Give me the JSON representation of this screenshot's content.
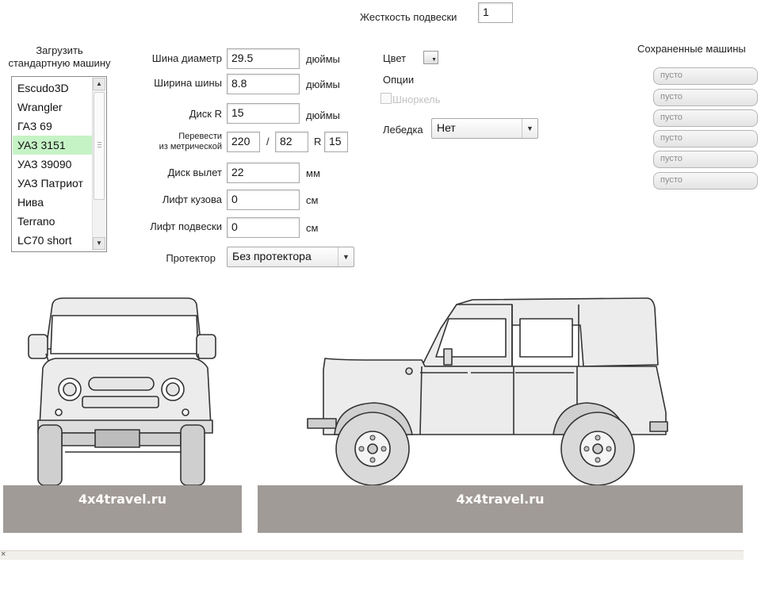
{
  "suspension": {
    "label": "Жесткость подвески",
    "value": "1"
  },
  "load_car": {
    "label_line1": "Загрузить",
    "label_line2": "стандартную машину"
  },
  "car_list": {
    "items": [
      "Escudo3D",
      "Wrangler",
      "ГАЗ 69",
      "УАЗ 3151",
      "УАЗ 39090",
      "УАЗ Патриот",
      "Нива",
      "Terrano",
      "LC70 short"
    ],
    "selected": "УАЗ 3151"
  },
  "fields": {
    "tire_diameter": {
      "label": "Шина диаметр",
      "value": "29.5",
      "unit": "дюймы"
    },
    "tire_width": {
      "label": "Ширина шины",
      "value": "8.8",
      "unit": "дюймы"
    },
    "rim": {
      "label": "Диск R",
      "value": "15",
      "unit": "дюймы"
    },
    "convert": {
      "label_line1": "Перевести",
      "label_line2": "из метрической",
      "width": "220",
      "sep": "/",
      "profile": "82",
      "r_label": "R",
      "radius": "15"
    },
    "offset": {
      "label": "Диск вылет",
      "value": "22",
      "unit": "мм"
    },
    "body_lift": {
      "label": "Лифт кузова",
      "value": "0",
      "unit": "см"
    },
    "susp_lift": {
      "label": "Лифт подвески",
      "value": "0",
      "unit": "см"
    },
    "tread": {
      "label": "Протектор",
      "value": "Без протектора"
    }
  },
  "color": {
    "label": "Цвет"
  },
  "options": {
    "label": "Опции",
    "snorkel": "Шноркель"
  },
  "winch": {
    "label": "Лебедка",
    "value": "Нет"
  },
  "saved": {
    "title": "Сохраненные машины",
    "slots": [
      "пусто",
      "пусто",
      "пусто",
      "пусто",
      "пусто",
      "пусто"
    ]
  },
  "watermark": {
    "front": "4x4travel.ru",
    "side": "4x4travel.ru"
  },
  "status": {
    "close": "×"
  },
  "icons": {
    "list_up": "triangle-up",
    "list_down": "triangle-down",
    "dropdown": "triangle-down"
  },
  "colors": {
    "selected_row": "#c6f3c6",
    "ground": "#a19b97",
    "car_fill": "#ececec",
    "tire": "#d9d9d9"
  }
}
